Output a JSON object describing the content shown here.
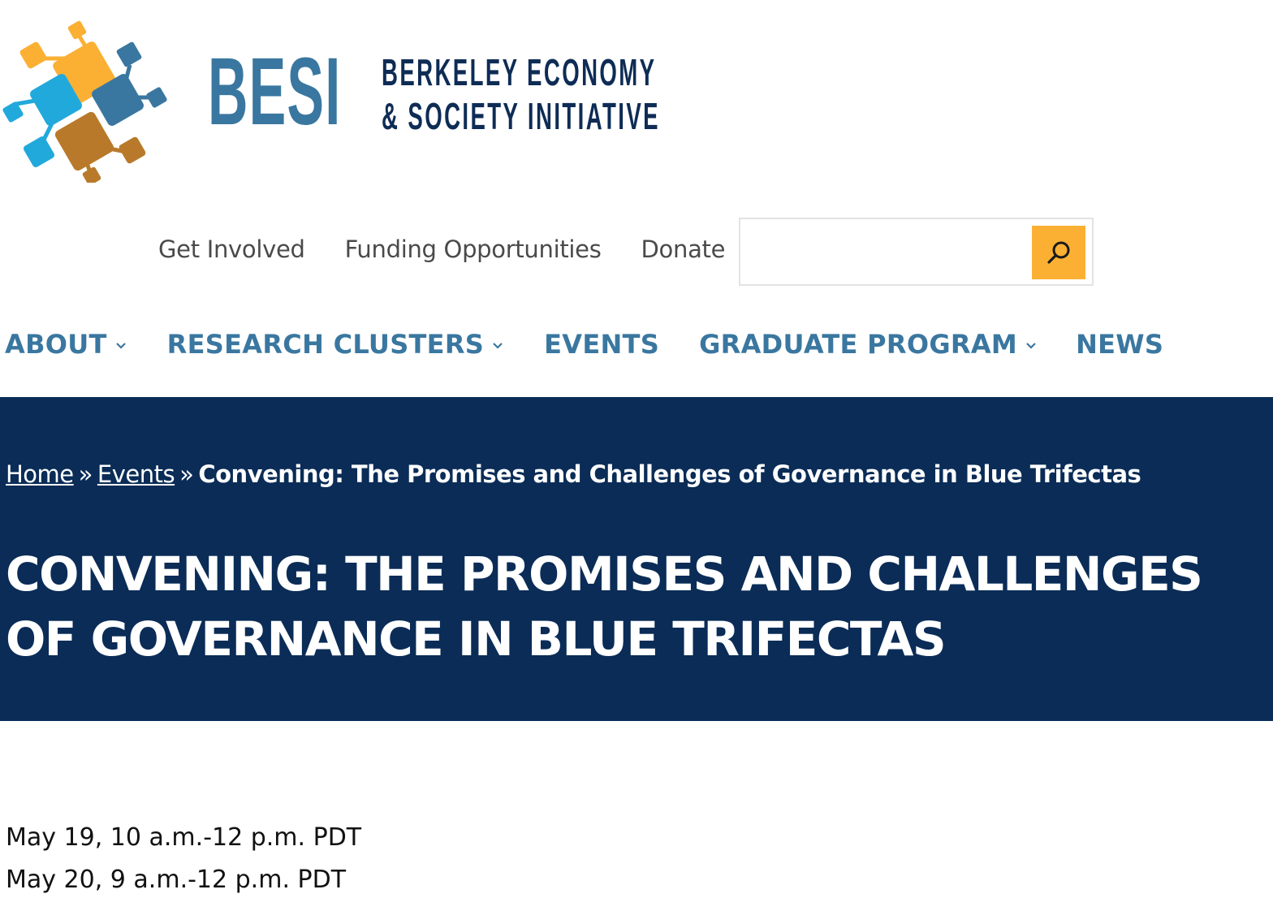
{
  "brand": {
    "logo_text": "BESI",
    "tagline_line1": "BERKELEY ECONOMY",
    "tagline_line2": "& SOCIETY INITIATIVE",
    "colors": {
      "blue": "#3a77a0",
      "navy": "#0e2c55",
      "orange": "#fbb034",
      "sky": "#22a9dc",
      "bronze": "#b87a2a"
    }
  },
  "utility_nav": [
    {
      "label": "Get Involved"
    },
    {
      "label": "Funding Opportunities"
    },
    {
      "label": "Donate"
    }
  ],
  "search": {
    "value": "",
    "placeholder": "",
    "icon": "search-icon"
  },
  "main_nav": [
    {
      "label": "ABOUT",
      "has_dropdown": true
    },
    {
      "label": "RESEARCH CLUSTERS",
      "has_dropdown": true
    },
    {
      "label": "EVENTS",
      "has_dropdown": false
    },
    {
      "label": "GRADUATE PROGRAM",
      "has_dropdown": true
    },
    {
      "label": "NEWS",
      "has_dropdown": false
    }
  ],
  "breadcrumb": {
    "home": "Home",
    "separator": "»",
    "events": "Events",
    "current": "Convening: The Promises and Challenges of Governance in Blue Trifectas"
  },
  "page_title": "Convening: The Promises and Challenges of Governance in Blue Trifectas",
  "event_times": [
    "May 19, 10 a.m.-12 p.m. PDT",
    "May 20, 9 a.m.-12 p.m. PDT"
  ],
  "theme": {
    "hero_bg": "#0a2c57",
    "nav_color": "#3a77a0",
    "search_button": "#fbb034"
  }
}
